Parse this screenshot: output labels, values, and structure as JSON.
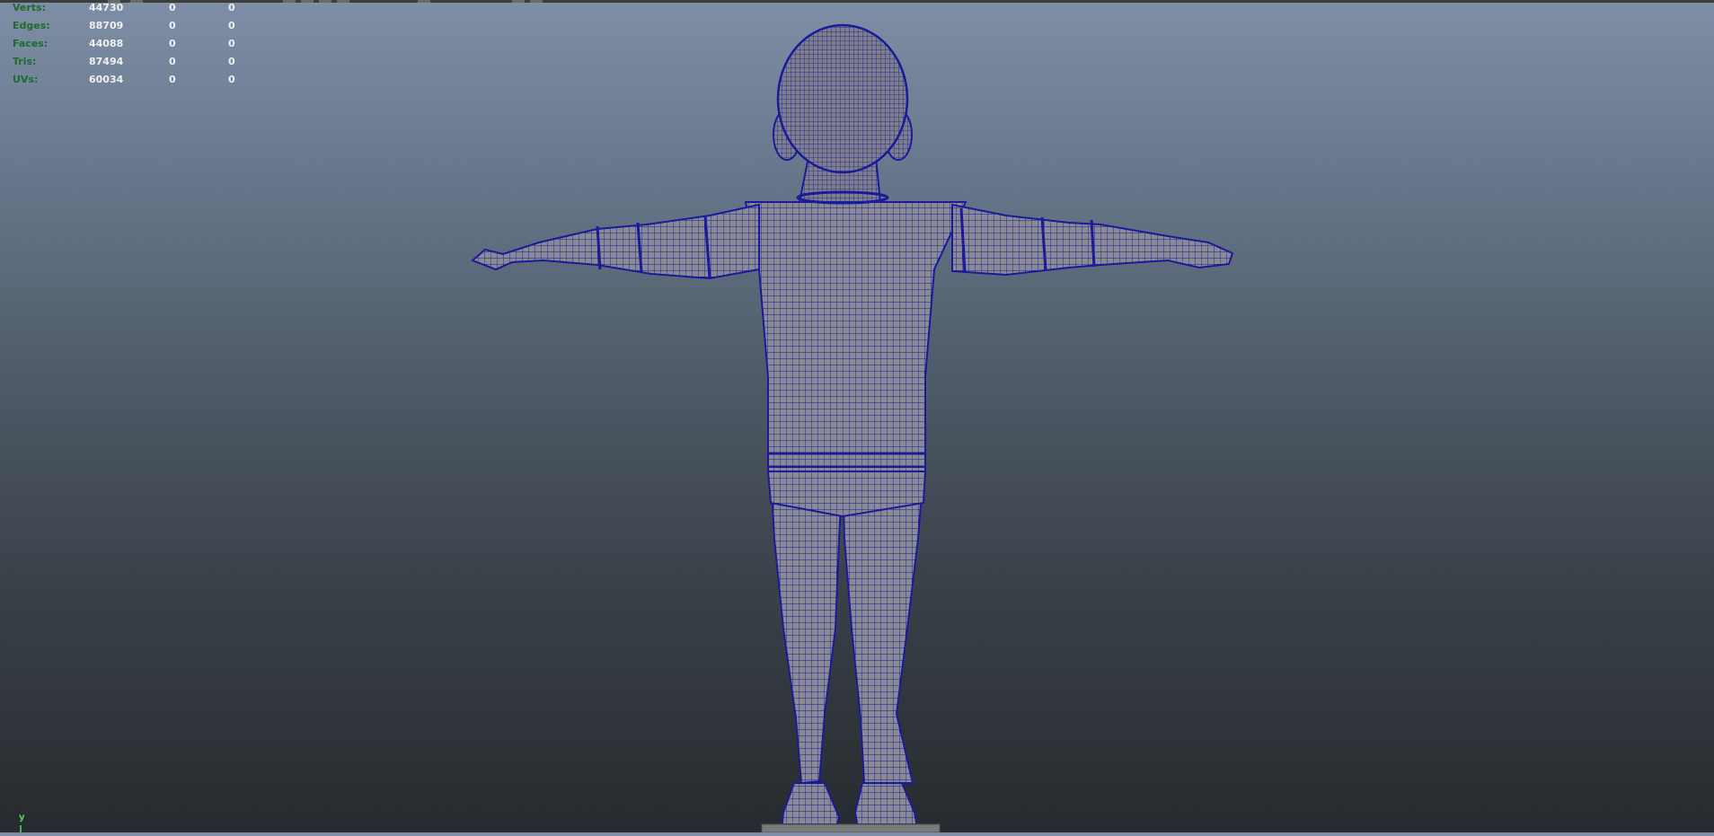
{
  "hud": {
    "rows": [
      {
        "label": "Verts:",
        "v1": "44730",
        "v2": "0",
        "v3": "0"
      },
      {
        "label": "Edges:",
        "v1": "88709",
        "v2": "0",
        "v3": "0"
      },
      {
        "label": "Faces:",
        "v1": "44088",
        "v2": "0",
        "v3": "0"
      },
      {
        "label": "Tris:",
        "v1": "87494",
        "v2": "0",
        "v3": "0"
      },
      {
        "label": "UVs:",
        "v1": "60034",
        "v2": "0",
        "v3": "0"
      }
    ]
  },
  "axis": {
    "y_label": "y"
  },
  "colors": {
    "wireframe": "#1a1a9a",
    "mesh_fill": "#8a8a94",
    "hud_label": "#1e6c2a",
    "axis_y": "#58d958"
  }
}
